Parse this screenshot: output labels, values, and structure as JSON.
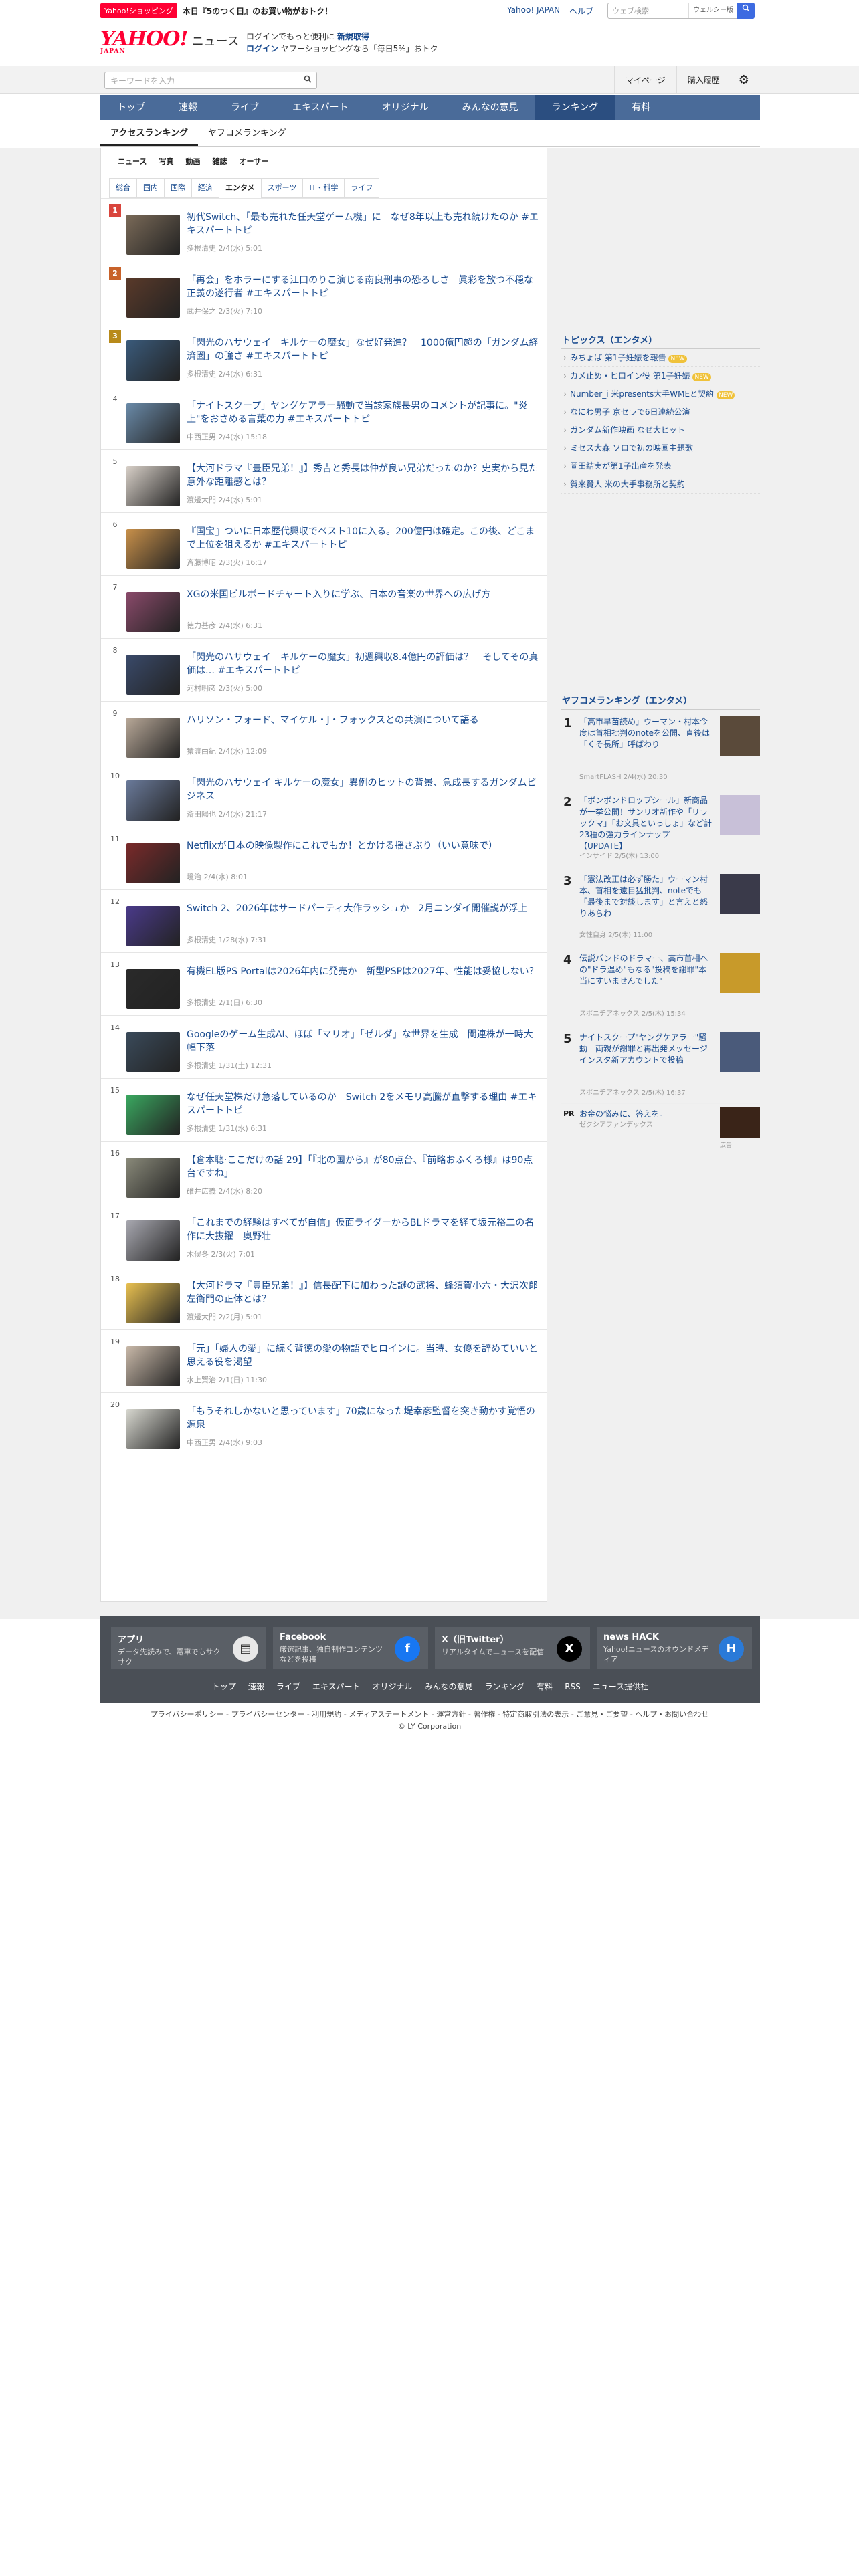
{
  "promo": {
    "tag": "Yahoo!ショッピング",
    "message": "本日『5のつく日』のお買い物がおトク！"
  },
  "toplinks": [
    "Yahoo! JAPAN",
    "ヘルプ"
  ],
  "websearch": {
    "placeholder": "ウェブ検索",
    "label": "ウェルシー版",
    "icon": "search-icon"
  },
  "logo": {
    "brand": "YAHOO!",
    "sub": "JAPAN",
    "section": "ニュース"
  },
  "header_promo": {
    "line1_pre": "ログインでもっと便利に",
    "line1_link": "新規取得",
    "line2_link": "ログイン",
    "line2_post": "ヤフーショッピングなら「毎日5%」おトク"
  },
  "kwsearch": {
    "placeholder": "キーワードを入力"
  },
  "sublinks": [
    "マイページ",
    "購入履歴"
  ],
  "nav": [
    "トップ",
    "速報",
    "ライブ",
    "エキスパート",
    "オリジナル",
    "みんなの意見",
    "ランキング",
    "有料"
  ],
  "nav_active": "ランキング",
  "rank_tabs": [
    "アクセスランキング",
    "ヤフコメランキング"
  ],
  "media_tabs": [
    "ニュース",
    "写真",
    "動画",
    "雑誌",
    "オーサー"
  ],
  "cat_tabs": [
    "総合",
    "国内",
    "国際",
    "経済",
    "エンタメ",
    "スポーツ",
    "IT・科学",
    "ライフ"
  ],
  "cat_active": "エンタメ",
  "colors": {
    "nav": "#4a6b99",
    "rank1": "#d9453d",
    "rank2": "#c8622a",
    "rank3": "#b88a1a",
    "link": "#1a4b8f"
  },
  "ranking": [
    {
      "num": "1",
      "title": "初代Switch､「最も売れた任天堂ゲーム機」に　なぜ8年以上も売れ続けたのか #エキスパートトピ",
      "meta": "多根清史  2/4(水) 5:01"
    },
    {
      "num": "2",
      "title": "「再会」をホラーにする江口のりこ演じる南良刑事の恐ろしさ　眞彩を放つ不穏な正義の遂行者 #エキスパートトピ",
      "meta": "武井保之  2/3(火) 7:10"
    },
    {
      "num": "3",
      "title": "「閃光のハサウェイ　キルケーの魔女」なぜ好発進？　1000億円超の「ガンダム経済圏」の強さ #エキスパートトピ",
      "meta": "多根清史  2/4(水) 6:31"
    },
    {
      "num": "4",
      "title": "「ナイトスクープ」ヤングケアラー騒動で当該家族長男のコメントが記事に。\"炎上\"をおさめる言葉の力 #エキスパートトピ",
      "meta": "中西正男  2/4(水) 15:18"
    },
    {
      "num": "5",
      "title": "【大河ドラマ『豊臣兄弟！』】秀吉と秀長は仲が良い兄弟だったのか？史実から見た意外な距離感とは？",
      "meta": "渡邊大門  2/4(水) 5:01"
    },
    {
      "num": "6",
      "title": "『国宝』ついに日本歴代興収でベスト10に入る。200億円は確定。この後、どこまで上位を狙えるか #エキスパートトピ",
      "meta": "斉藤博昭  2/3(火) 16:17"
    },
    {
      "num": "7",
      "title": "XGの米国ビルボードチャート入りに学ぶ、日本の音楽の世界への広げ方",
      "meta": "徳力基彦  2/4(水) 6:31"
    },
    {
      "num": "8",
      "title": "「閃光のハサウェイ　キルケーの魔女」初週興収8.4億円の評価は？　そしてその真価は… #エキスパートトピ",
      "meta": "河村明彦  2/3(火) 5:00"
    },
    {
      "num": "9",
      "title": "ハリソン・フォード、マイケル・J・フォックスとの共演について語る",
      "meta": "猿渡由紀  2/4(水) 12:09"
    },
    {
      "num": "10",
      "title": "「閃光のハサウェイ キルケーの魔女」異例のヒットの背景、急成長するガンダムビジネス",
      "meta": "斎田陽也  2/4(水) 21:17"
    },
    {
      "num": "11",
      "title": "Netflixが日本の映像製作にこれでもか！とかける揺さぶり（いい意味で）",
      "meta": "境治  2/4(水) 8:01"
    },
    {
      "num": "12",
      "title": "Switch 2、2026年はサードパーティ大作ラッシュか　2月ニンダイ開催説が浮上",
      "meta": "多根清史  1/28(水) 7:31"
    },
    {
      "num": "13",
      "title": "有機EL版PS Portalは2026年内に発売か　新型PSPは2027年、性能は妥協しない？",
      "meta": "多根清史  2/1(日) 6:30"
    },
    {
      "num": "14",
      "title": "Googleのゲーム生成AI、ほぼ「マリオ」「ゼルダ」な世界を生成　関連株が一時大幅下落",
      "meta": "多根清史  1/31(土) 12:31"
    },
    {
      "num": "15",
      "title": "なぜ任天堂株だけ急落しているのか　Switch 2をメモリ高騰が直撃する理由 #エキスパートトピ",
      "meta": "多根清史  1/31(水) 6:31"
    },
    {
      "num": "16",
      "title": "【倉本聰·ここだけの話 29】「『北の国から』が80点台、『前略おふくろ様』は90点台ですね」",
      "meta": "碓井広義  2/4(水) 8:20"
    },
    {
      "num": "17",
      "title": "「これまでの経験はすべてが自信」仮面ライダーからBLドラマを経て坂元裕二の名作に大抜擢　奥野壮",
      "meta": "木俣冬  2/3(火) 7:01"
    },
    {
      "num": "18",
      "title": "【大河ドラマ『豊臣兄弟！』】信長配下に加わった謎の武将、蜂須賀小六・大沢次郎左衛門の正体とは？",
      "meta": "渡邊大門  2/2(月) 5:01"
    },
    {
      "num": "19",
      "title": "「元」「婦人の愛」に続く背徳の愛の物語でヒロインに。当時、女優を辞めていいと思える役を渇望",
      "meta": "水上賢治  2/1(日) 11:30"
    },
    {
      "num": "20",
      "title": "「もうそれしかないと思っています」70歳になった堤幸彦監督を突き動かす覚悟の源泉",
      "meta": "中西正男  2/4(水) 9:03"
    }
  ],
  "topics": {
    "title": "トピックス（エンタメ）",
    "items": [
      {
        "text": "みちょぱ 第1子妊娠を報告",
        "new": "NEW"
      },
      {
        "text": "カメ止め・ヒロイン役 第1子妊娠",
        "new": "NEW"
      },
      {
        "text": "Number_i 米presents大手WMEと契約",
        "new": "NEW"
      },
      {
        "text": "なにわ男子 京セラで6日連続公演",
        "new": ""
      },
      {
        "text": "ガンダム新作映画 なぜ大ヒット",
        "new": ""
      },
      {
        "text": "ミセス大森 ソロで初の映画主題歌",
        "new": ""
      },
      {
        "text": "岡田結実が第1子出産を発表",
        "new": ""
      },
      {
        "text": "賀来賢人 米の大手事務所と契約",
        "new": ""
      }
    ]
  },
  "yrank": {
    "title": "ヤフコメランキング（エンタメ）",
    "items": [
      {
        "num": "1",
        "title": "「高市早苗読め」ウーマン・村本今度は首相批判のnoteを公開、直後は「くそ長所」呼ばわり",
        "meta": "SmartFLASH 2/4(水) 20:30"
      },
      {
        "num": "2",
        "title": "「ボンボンドロップシール」新商品が一挙公開！サンリオ新作や「リラックマ」「お文具といっしょ」など計23種の強力ラインナップ【UPDATE】",
        "meta": "インサイド 2/5(木) 13:00"
      },
      {
        "num": "3",
        "title": "「憲法改正は必ず勝た」ウーマン村本、首相を遠目猛批判、noteでも「最後まで対談します」と言えと怒りあらわ",
        "meta": "女性自身 2/5(木) 11:00"
      },
      {
        "num": "4",
        "title": "伝説バンドのドラマー、高市首相への\"ドラ温め\"もなる\"投稿を謝罪\"本当にすいませんでした\"",
        "meta": "スポニチアネックス 2/5(木) 15:34"
      },
      {
        "num": "5",
        "title": "ナイトスクープ\"ヤングケアラー\"騒動　両親が謝罪と再出発メッセージ　インスタ新アカウントで投稿",
        "meta": "スポニチアネックス 2/5(木) 16:37"
      }
    ]
  },
  "pr": {
    "label": "PR",
    "title": "お金の悩みに、答えを。",
    "sponsor": "ゼクシアファンデックス",
    "ad": "広告"
  },
  "footer_apps": [
    {
      "title": "アプリ",
      "desc": "データ先読みで、電車でもサクサク",
      "icon": "yahoo-news-app-icon"
    },
    {
      "title": "Facebook",
      "desc": "厳選記事、独自制作コンテンツなどを投稿",
      "icon": "facebook-icon"
    },
    {
      "title": "X（旧Twitter）",
      "desc": "リアルタイムでニュースを配信",
      "icon": "x-icon"
    },
    {
      "title": "news HACK",
      "desc": "Yahoo!ニュースのオウンドメディア",
      "icon": "newshack-icon"
    }
  ],
  "footer_nav": [
    "トップ",
    "速報",
    "ライブ",
    "エキスパート",
    "オリジナル",
    "みんなの意見",
    "ランキング",
    "有料",
    "RSS",
    "ニュース提供社"
  ],
  "legal_line": "プライバシーポリシー - プライバシーセンター - 利用規約 - メディアステートメント - 運営方針 - 著作権 - 特定商取引法の表示 - ご意見・ご要望 - ヘルプ・お問い合わせ",
  "copyright": "© LY Corporation"
}
